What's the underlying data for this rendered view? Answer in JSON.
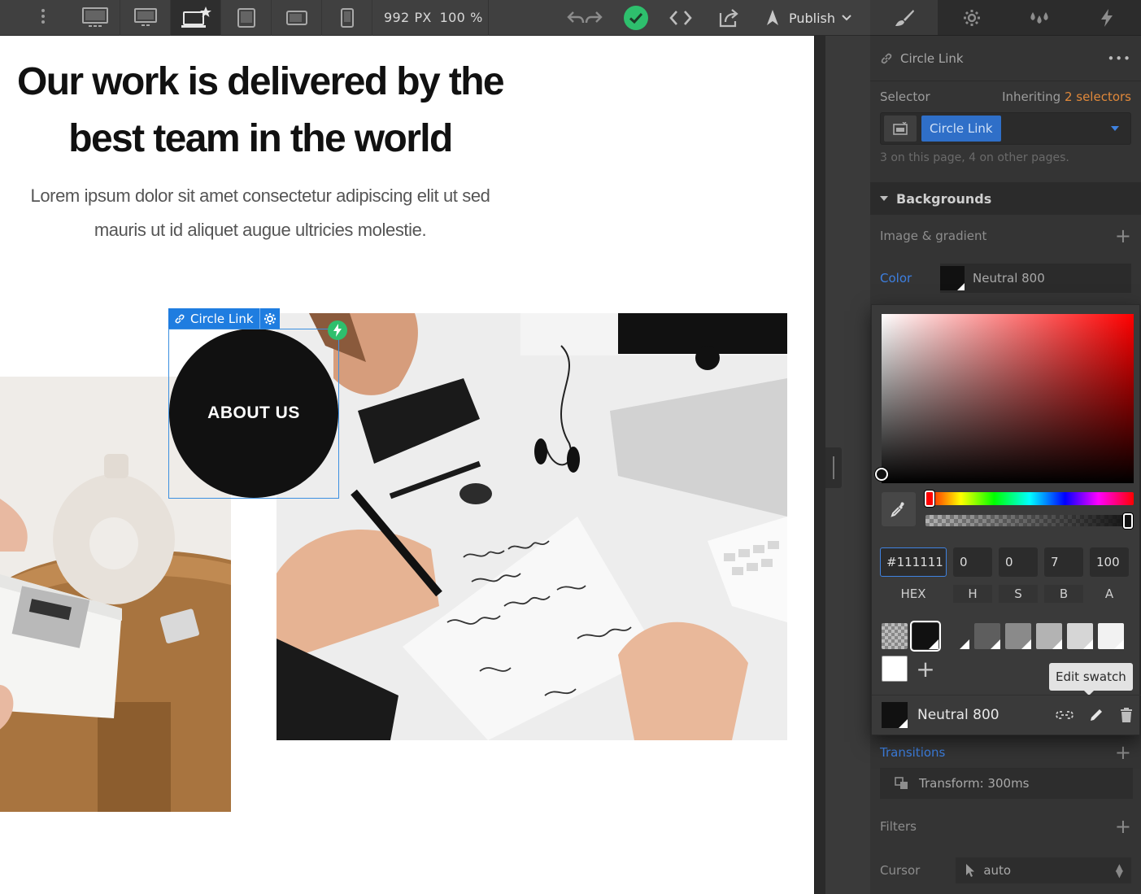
{
  "toolbar": {
    "width_value": "992",
    "width_unit": "PX",
    "zoom_value": "100",
    "zoom_unit": "%",
    "publish_label": "Publish"
  },
  "canvas": {
    "heading_line1": "Our work is delivered by the",
    "heading_line2": "best team in the world",
    "subtext_line1": "Lorem ipsum dolor sit amet consectetur adipiscing elit ut sed",
    "subtext_line2": "mauris ut id aliquet augue ultricies molestie.",
    "circle_label": "ABOUT US",
    "selected_element_label": "Circle Link"
  },
  "panel": {
    "element_name": "Circle Link",
    "more_label": "•••",
    "selector_label": "Selector",
    "inheriting_prefix": "Inheriting",
    "inheriting_count": "2 selectors",
    "selector_chip": "Circle Link",
    "selector_note": "3 on this page, 4 on other pages.",
    "backgrounds_title": "Backgrounds",
    "image_gradient_label": "Image & gradient",
    "color_label": "Color",
    "color_value": "Neutral 800",
    "transitions_label": "Transitions",
    "transform_value": "Transform: 300ms",
    "filters_label": "Filters",
    "cursor_label": "Cursor",
    "cursor_value": "auto"
  },
  "picker": {
    "hex_value": "#111111",
    "h_value": "0",
    "s_value": "0",
    "b_value": "7",
    "a_value": "100",
    "hex_label": "HEX",
    "h_label": "H",
    "s_label": "S",
    "b_label": "B",
    "a_label": "A",
    "swatches": [
      "transparent",
      "#111111",
      "#3a3a3a",
      "#5e5e5e",
      "#8a8a8a",
      "#b3b3b3",
      "#d6d6d6",
      "#f2f2f2",
      "#ffffff"
    ],
    "tooltip": "Edit swatch",
    "selected_swatch_name": "Neutral 800"
  },
  "colors": {
    "accent_blue": "#1f7de0",
    "success_green": "#2ebf6d",
    "warning_orange": "#e0883a",
    "panel_bg": "#343434"
  }
}
